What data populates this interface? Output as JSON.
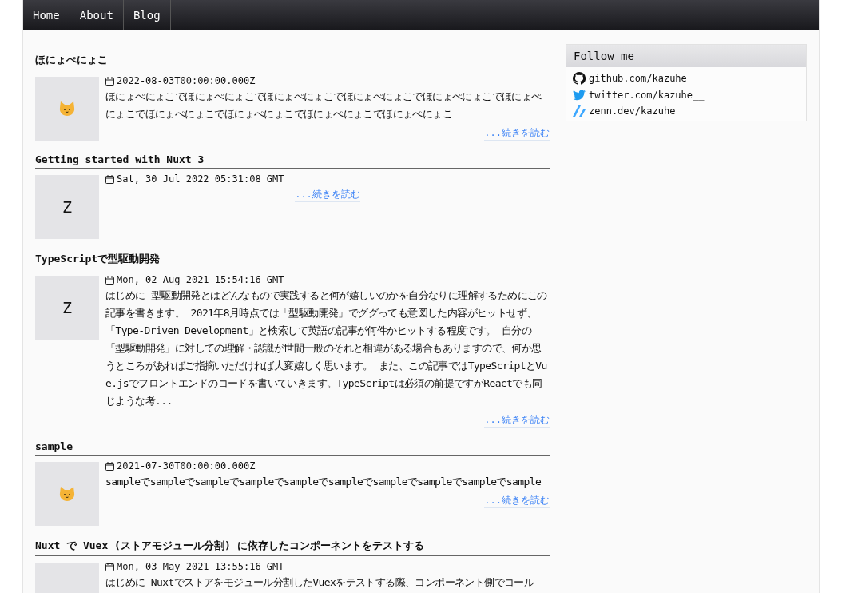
{
  "nav": [
    {
      "label": "Home"
    },
    {
      "label": "About"
    },
    {
      "label": "Blog"
    }
  ],
  "articles": [
    {
      "title": "ほにょぺにょこ",
      "thumb": {
        "kind": "cat"
      },
      "date": "2022-08-03T00:00:00.000Z",
      "excerpt": "ほにょぺにょこでほにょぺにょこでほにょぺにょこでほにょぺにょこでほにょぺにょこでほにょぺにょこでほにょぺにょこでほにょぺにょこでほにょぺにょこでほにょぺにょこ",
      "more": "...続きを読む"
    },
    {
      "title": "Getting started with Nuxt 3",
      "thumb": {
        "kind": "letter",
        "text": "Z"
      },
      "date": "Sat, 30 Jul 2022 05:31:08 GMT",
      "more": "...続きを読む"
    },
    {
      "title": "TypeScriptで型駆動開発",
      "thumb": {
        "kind": "letter",
        "text": "Z"
      },
      "date": "Mon, 02 Aug 2021 15:54:16 GMT",
      "excerpt": "はじめに 型駆動開発とはどんなもので実践すると何が嬉しいのかを自分なりに理解するためにこの記事を書きます。 2021年8月時点では「型駆動開発」でググっても意図した内容がヒットせず、「Type-Driven Development」と検索して英語の記事が何件かヒットする程度です。 自分の「型駆動開発」に対しての理解・認識が世間一般のそれと相違がある場合もありますので、何か思うところがあればご指摘いただければ大変嬉しく思います。 また、この記事ではTypeScriptとVue.jsでフロントエンドのコードを書いていきます。TypeScriptは必須の前提ですがReactでも同じような考...",
      "more": "...続きを読む"
    },
    {
      "title": "sample",
      "thumb": {
        "kind": "cat"
      },
      "date": "2021-07-30T00:00:00.000Z",
      "excerpt": "sampleでsampleでsampleでsampleでsampleでsampleでsampleでsampleでsampleでsample",
      "more": "...続きを読む"
    },
    {
      "title": "Nuxt で Vuex (ストアモジュール分割) に依存したコンポーネントをテストする",
      "thumb": {
        "kind": "plain"
      },
      "date": "Mon, 03 May 2021 13:55:16 GMT",
      "excerpt": "はじめに Nuxtでストアをモジュール分割したVuexをテストする際、コンポーネント側でコール"
    }
  ],
  "sidebar": {
    "title": "Follow me",
    "links": [
      {
        "kind": "github",
        "label": "github.com/kazuhe"
      },
      {
        "kind": "twitter",
        "label": "twitter.com/kazuhe__"
      },
      {
        "kind": "zenn",
        "label": "zenn.dev/kazuhe"
      }
    ]
  }
}
